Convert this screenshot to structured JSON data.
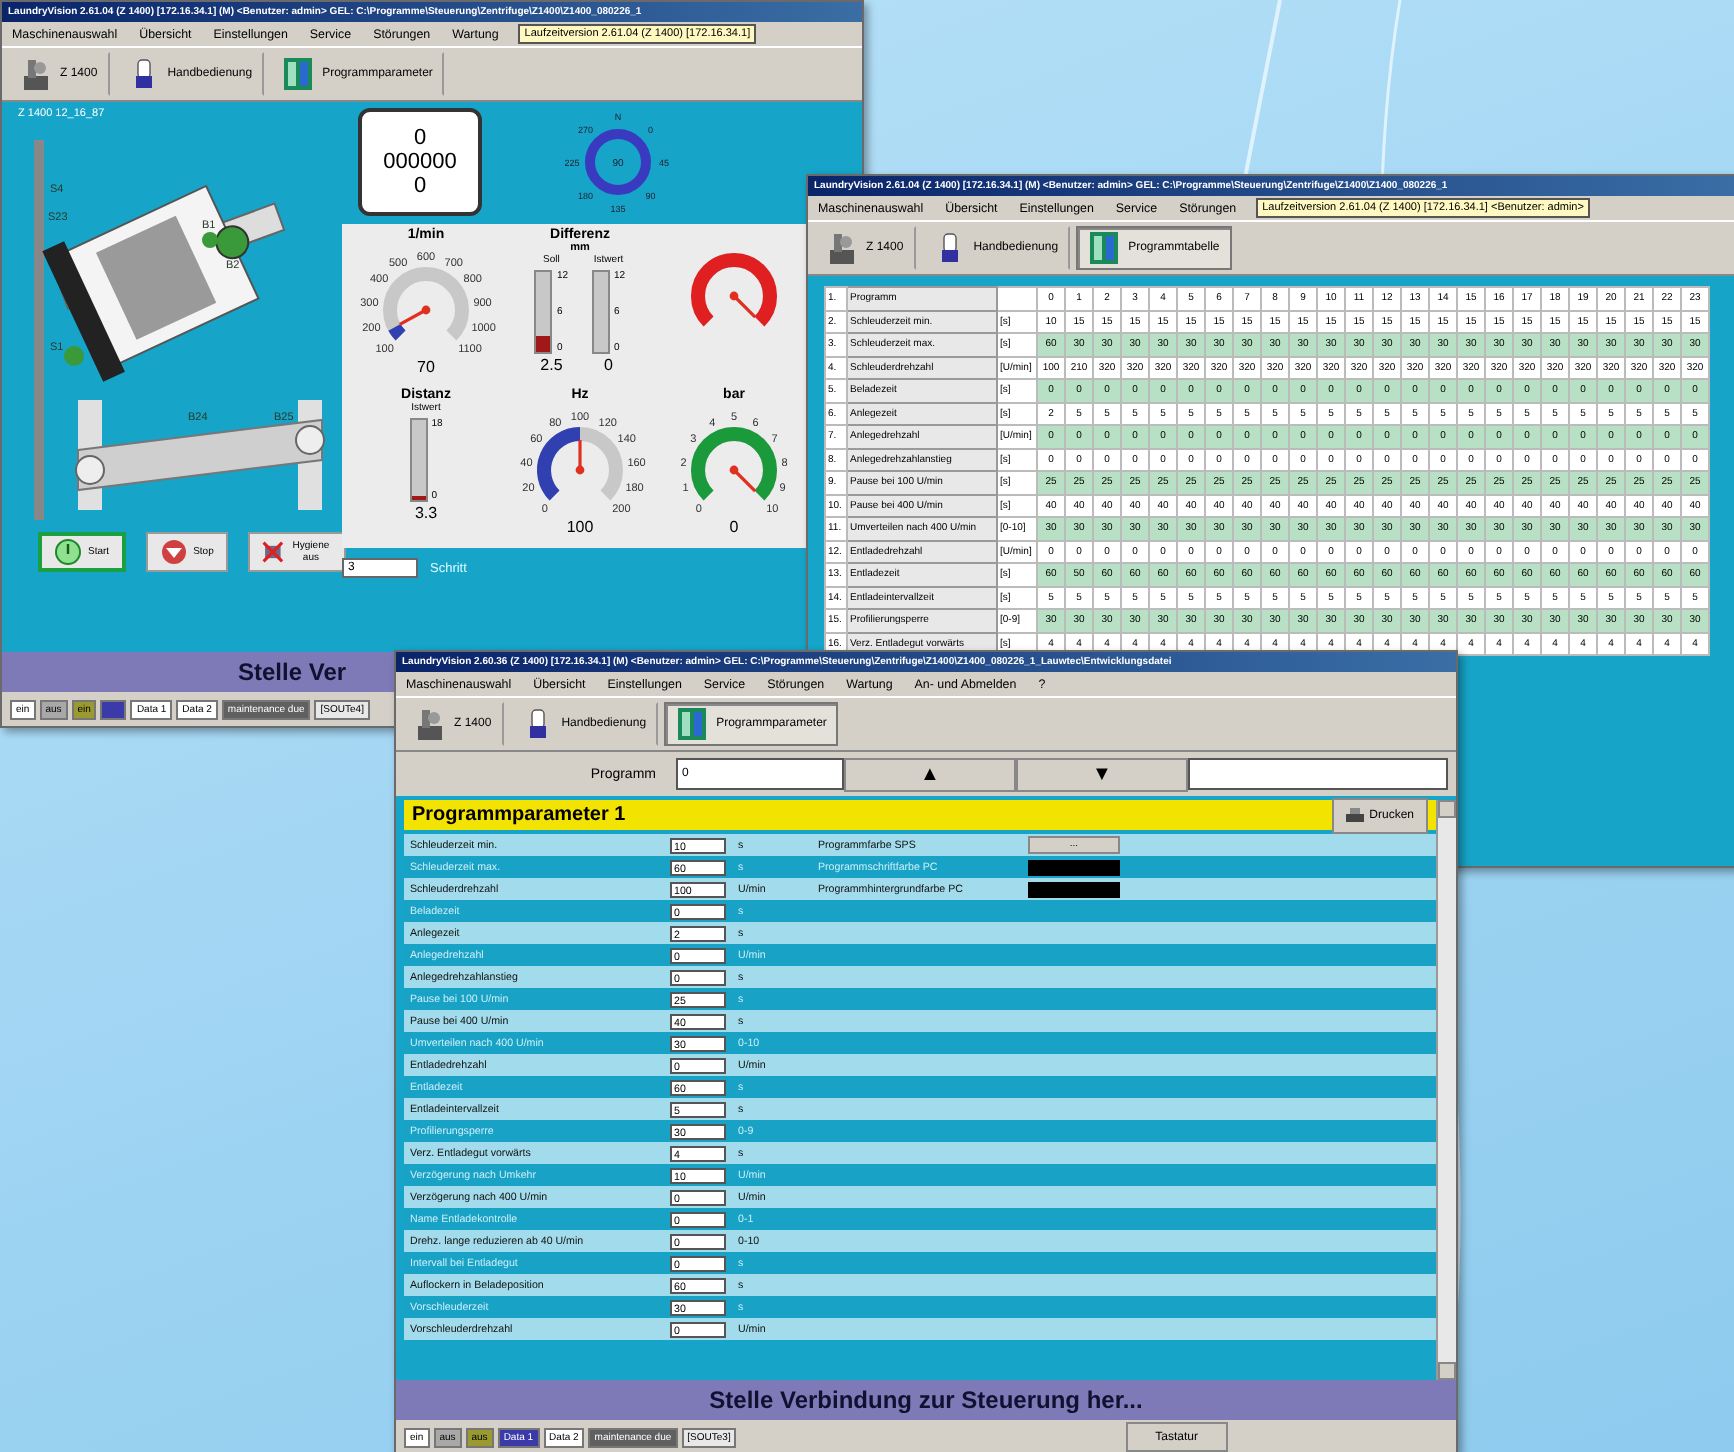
{
  "machine_window": {
    "title": "LaundryVision 2.61.04 (Z 1400) [172.16.34.1] (M) <Benutzer: admin> GEL: C:\\Programme\\Steuerung\\Zentrifuge\\Z1400\\Z1400_080226_1",
    "menu": [
      "Maschinenauswahl",
      "Übersicht",
      "Einstellungen",
      "Service",
      "Störungen",
      "Wartung"
    ],
    "path_box": "Laufzeitversion 2.61.04 (Z 1400) [172.16.34.1]",
    "toolbar": [
      {
        "label": "Z 1400",
        "selected": false
      },
      {
        "label": "Handbedienung",
        "selected": false
      },
      {
        "label": "Programmparameter",
        "selected": false
      }
    ],
    "machine_label": "Z 1400 12_16_87",
    "drawing_labels": [
      "S4",
      "S23",
      "S1",
      "B1",
      "B2",
      "B24",
      "B25"
    ],
    "counter": [
      "0",
      "000000",
      "0"
    ],
    "compass": {
      "center": "90",
      "labels": [
        "N",
        "0",
        "45",
        "90",
        "135",
        "180",
        "225",
        "270"
      ]
    },
    "gauges": [
      {
        "kind": "dial",
        "title": "1/min",
        "ticks": [
          "100",
          "200",
          "300",
          "400",
          "500",
          "600",
          "700",
          "800",
          "900",
          "1000",
          "1100"
        ],
        "reading": "70",
        "level": 0.06,
        "color": "#3040b0"
      },
      {
        "kind": "bars",
        "title": "Differenz",
        "unit": "mm",
        "bars": [
          {
            "label": "Soll",
            "ticks": [
              "12",
              "6",
              "0"
            ],
            "reading": "2.5",
            "level": 0.2
          },
          {
            "label": "Istwert",
            "ticks": [
              "12",
              "6",
              "0"
            ],
            "reading": "0",
            "level": 0
          }
        ]
      },
      {
        "kind": "dial",
        "level": 1,
        "color": "#e02020"
      },
      {
        "kind": "bars",
        "title": "Distanz",
        "bars": [
          {
            "label": "Istwert",
            "ticks": [
              "18",
              "0"
            ],
            "reading": "3.3",
            "level": 0.05
          }
        ]
      },
      {
        "kind": "dial",
        "title": "Hz",
        "ticks": [
          "0",
          "20",
          "40",
          "60",
          "80",
          "100",
          "120",
          "140",
          "160",
          "180",
          "200"
        ],
        "reading": "100",
        "level": 0.5,
        "color": "#3040b0"
      },
      {
        "kind": "dial",
        "title": "bar",
        "ticks": [
          "0",
          "1",
          "2",
          "3",
          "4",
          "5",
          "6",
          "7",
          "8",
          "9",
          "10"
        ],
        "reading": "0",
        "level": 1,
        "color": "#1a9a3a"
      }
    ],
    "step": {
      "value": "3",
      "label": "Schritt"
    },
    "buttons": [
      {
        "kind": "start",
        "label": "Start"
      },
      {
        "kind": "stop",
        "label": "Stop"
      },
      {
        "kind": "hygiene",
        "label": "Hygiene aus"
      }
    ],
    "status_message": "Stelle Ver",
    "status_bar": [
      {
        "kind": "text",
        "text": "ein",
        "color": "#ffffff"
      },
      {
        "kind": "text",
        "text": "aus",
        "color": "#a8a8a8"
      },
      {
        "kind": "text",
        "text": "ein",
        "color": "#9a9a30"
      },
      {
        "kind": "swatch",
        "color": "#3a3aa8"
      },
      {
        "kind": "text",
        "text": "Data 1",
        "color": "#ffffff"
      },
      {
        "kind": "text",
        "text": "Data 2",
        "color": "#ffffff"
      },
      {
        "kind": "text",
        "text": "maintenance due",
        "color": "#606060"
      },
      {
        "kind": "text",
        "text": "[SOUTe4]",
        "color": "#e8e8e8"
      }
    ]
  },
  "table_window": {
    "title": "LaundryVision 2.61.04 (Z 1400) [172.16.34.1] (M) <Benutzer: admin> GEL: C:\\Programme\\Steuerung\\Zentrifuge\\Z1400\\Z1400_080226_1",
    "menu": [
      "Maschinenauswahl",
      "Übersicht",
      "Einstellungen",
      "Service",
      "Störungen"
    ],
    "path_box": "Laufzeitversion 2.61.04 (Z 1400) [172.16.34.1] <Benutzer: admin>",
    "toolbar": [
      {
        "label": "Z 1400",
        "selected": false
      },
      {
        "label": "Handbedienung",
        "selected": false
      },
      {
        "label": "Programmtabelle",
        "selected": true
      }
    ],
    "rows": [
      {
        "number": "1.",
        "name": "Programm",
        "values": [
          "0",
          "1",
          "2",
          "3",
          "4",
          "5",
          "6",
          "7",
          "8",
          "9",
          "10",
          "11",
          "12",
          "13",
          "14",
          "15",
          "16",
          "17",
          "18",
          "19",
          "20",
          "21",
          "22",
          "23"
        ]
      },
      {
        "number": "2.",
        "name": "Schleuderzeit min.",
        "unit": "[s]",
        "values": [
          "10",
          "15",
          "15",
          "15",
          "15",
          "15",
          "15",
          "15",
          "15",
          "15",
          "15",
          "15",
          "15",
          "15",
          "15",
          "15",
          "15",
          "15",
          "15",
          "15",
          "15",
          "15",
          "15",
          "15"
        ]
      },
      {
        "number": "3.",
        "name": "Schleuderzeit max.",
        "unit": "[s]",
        "values": [
          "60",
          "30",
          "30",
          "30",
          "30",
          "30",
          "30",
          "30",
          "30",
          "30",
          "30",
          "30",
          "30",
          "30",
          "30",
          "30",
          "30",
          "30",
          "30",
          "30",
          "30",
          "30",
          "30",
          "30"
        ]
      },
      {
        "number": "4.",
        "name": "Schleuderdrehzahl",
        "unit": "[U/min]",
        "values": [
          "100",
          "210",
          "320",
          "320",
          "320",
          "320",
          "320",
          "320",
          "320",
          "320",
          "320",
          "320",
          "320",
          "320",
          "320",
          "320",
          "320",
          "320",
          "320",
          "320",
          "320",
          "320",
          "320",
          "320"
        ]
      },
      {
        "number": "5.",
        "name": "Beladezeit",
        "unit": "[s]",
        "values": [
          "0",
          "0",
          "0",
          "0",
          "0",
          "0",
          "0",
          "0",
          "0",
          "0",
          "0",
          "0",
          "0",
          "0",
          "0",
          "0",
          "0",
          "0",
          "0",
          "0",
          "0",
          "0",
          "0",
          "0"
        ]
      },
      {
        "number": "6.",
        "name": "Anlegezeit",
        "unit": "[s]",
        "values": [
          "2",
          "5",
          "5",
          "5",
          "5",
          "5",
          "5",
          "5",
          "5",
          "5",
          "5",
          "5",
          "5",
          "5",
          "5",
          "5",
          "5",
          "5",
          "5",
          "5",
          "5",
          "5",
          "5",
          "5"
        ]
      },
      {
        "number": "7.",
        "name": "Anlegedrehzahl",
        "unit": "[U/min]",
        "values": [
          "0",
          "0",
          "0",
          "0",
          "0",
          "0",
          "0",
          "0",
          "0",
          "0",
          "0",
          "0",
          "0",
          "0",
          "0",
          "0",
          "0",
          "0",
          "0",
          "0",
          "0",
          "0",
          "0",
          "0"
        ]
      },
      {
        "number": "8.",
        "name": "Anlegedrehzahlanstieg",
        "unit": "[s]",
        "values": [
          "0",
          "0",
          "0",
          "0",
          "0",
          "0",
          "0",
          "0",
          "0",
          "0",
          "0",
          "0",
          "0",
          "0",
          "0",
          "0",
          "0",
          "0",
          "0",
          "0",
          "0",
          "0",
          "0",
          "0"
        ]
      },
      {
        "number": "9.",
        "name": "Pause bei 100 U/min",
        "unit": "[s]",
        "values": [
          "25",
          "25",
          "25",
          "25",
          "25",
          "25",
          "25",
          "25",
          "25",
          "25",
          "25",
          "25",
          "25",
          "25",
          "25",
          "25",
          "25",
          "25",
          "25",
          "25",
          "25",
          "25",
          "25",
          "25"
        ]
      },
      {
        "number": "10.",
        "name": "Pause bei 400 U/min",
        "unit": "[s]",
        "values": [
          "40",
          "40",
          "40",
          "40",
          "40",
          "40",
          "40",
          "40",
          "40",
          "40",
          "40",
          "40",
          "40",
          "40",
          "40",
          "40",
          "40",
          "40",
          "40",
          "40",
          "40",
          "40",
          "40",
          "40"
        ]
      },
      {
        "number": "11.",
        "name": "Umverteilen nach 400 U/min",
        "unit": "[0-10]",
        "values": [
          "30",
          "30",
          "30",
          "30",
          "30",
          "30",
          "30",
          "30",
          "30",
          "30",
          "30",
          "30",
          "30",
          "30",
          "30",
          "30",
          "30",
          "30",
          "30",
          "30",
          "30",
          "30",
          "30",
          "30"
        ]
      },
      {
        "number": "12.",
        "name": "Entladedrehzahl",
        "unit": "[U/min]",
        "values": [
          "0",
          "0",
          "0",
          "0",
          "0",
          "0",
          "0",
          "0",
          "0",
          "0",
          "0",
          "0",
          "0",
          "0",
          "0",
          "0",
          "0",
          "0",
          "0",
          "0",
          "0",
          "0",
          "0",
          "0"
        ]
      },
      {
        "number": "13.",
        "name": "Entladezeit",
        "unit": "[s]",
        "values": [
          "60",
          "50",
          "60",
          "60",
          "60",
          "60",
          "60",
          "60",
          "60",
          "60",
          "60",
          "60",
          "60",
          "60",
          "60",
          "60",
          "60",
          "60",
          "60",
          "60",
          "60",
          "60",
          "60",
          "60"
        ]
      },
      {
        "number": "14.",
        "name": "Entladeintervallzeit",
        "unit": "[s]",
        "values": [
          "5",
          "5",
          "5",
          "5",
          "5",
          "5",
          "5",
          "5",
          "5",
          "5",
          "5",
          "5",
          "5",
          "5",
          "5",
          "5",
          "5",
          "5",
          "5",
          "5",
          "5",
          "5",
          "5",
          "5"
        ]
      },
      {
        "number": "15.",
        "name": "Profilierungsperre",
        "unit": "[0-9]",
        "values": [
          "30",
          "30",
          "30",
          "30",
          "30",
          "30",
          "30",
          "30",
          "30",
          "30",
          "30",
          "30",
          "30",
          "30",
          "30",
          "30",
          "30",
          "30",
          "30",
          "30",
          "30",
          "30",
          "30",
          "30"
        ]
      },
      {
        "number": "16.",
        "name": "Verz. Entladegut vorwärts",
        "unit": "[s]",
        "values": [
          "4",
          "4",
          "4",
          "4",
          "4",
          "4",
          "4",
          "4",
          "4",
          "4",
          "4",
          "4",
          "4",
          "4",
          "4",
          "4",
          "4",
          "4",
          "4",
          "4",
          "4",
          "4",
          "4",
          "4"
        ]
      }
    ]
  },
  "param_window": {
    "title": "LaundryVision 2.60.36 (Z 1400) [172.16.34.1] (M) <Benutzer: admin> GEL: C:\\Programme\\Steuerung\\Zentrifuge\\Z1400\\Z1400_080226_1_Lauwtec\\Entwicklungsdatei",
    "menu": [
      "Maschinenauswahl",
      "Übersicht",
      "Einstellungen",
      "Service",
      "Störungen",
      "Wartung",
      "An- und Abmelden",
      "?"
    ],
    "toolbar": [
      {
        "label": "Z 1400",
        "selected": false
      },
      {
        "label": "Handbedienung",
        "selected": false
      },
      {
        "label": "Programmparameter",
        "selected": true
      }
    ],
    "program": {
      "label": "Programm",
      "value": "0",
      "up": "▲",
      "down": "▼"
    },
    "header": "Programmparameter 1",
    "print_button": "Drucken",
    "color_settings": [
      {
        "kind": "button",
        "label": "Programmfarbe SPS",
        "text": "..."
      },
      {
        "kind": "swatch",
        "label": "Programmschriftfarbe PC",
        "color": "#000000"
      },
      {
        "kind": "swatch",
        "label": "Programmhintergrundfarbe PC",
        "color": "#000000"
      }
    ],
    "params": [
      {
        "name": "Schleuderzeit min.",
        "value": "10",
        "unit": "s"
      },
      {
        "name": "Schleuderzeit max.",
        "value": "60",
        "unit": "s"
      },
      {
        "name": "Schleuderdrehzahl",
        "value": "100",
        "unit": "U/min"
      },
      {
        "name": "Beladezeit",
        "value": "0",
        "unit": "s"
      },
      {
        "name": "Anlegezeit",
        "value": "2",
        "unit": "s"
      },
      {
        "name": "Anlegedrehzahl",
        "value": "0",
        "unit": "U/min"
      },
      {
        "name": "Anlegedrehzahlanstieg",
        "value": "0",
        "unit": "s"
      },
      {
        "name": "Pause bei 100 U/min",
        "value": "25",
        "unit": "s"
      },
      {
        "name": "Pause bei 400 U/min",
        "value": "40",
        "unit": "s"
      },
      {
        "name": "Umverteilen nach 400 U/min",
        "value": "30",
        "unit": "0-10"
      },
      {
        "name": "Entladedrehzahl",
        "value": "0",
        "unit": "U/min"
      },
      {
        "name": "Entladezeit",
        "value": "60",
        "unit": "s"
      },
      {
        "name": "Entladeintervallzeit",
        "value": "5",
        "unit": "s"
      },
      {
        "name": "Profilierungsperre",
        "value": "30",
        "unit": "0-9"
      },
      {
        "name": "Verz. Entladegut vorwärts",
        "value": "4",
        "unit": "s"
      },
      {
        "name": "Verzögerung nach Umkehr",
        "value": "10",
        "unit": "U/min"
      },
      {
        "name": "Verzögerung nach 400 U/min",
        "value": "0",
        "unit": "U/min"
      },
      {
        "name": "Name Entladekontrolle",
        "value": "0",
        "unit": "0-1"
      },
      {
        "name": "Drehz. lange reduzieren ab 40 U/min",
        "value": "0",
        "unit": "0-10"
      },
      {
        "name": "Intervall bei Entladegut",
        "value": "0",
        "unit": "s"
      },
      {
        "name": "Auflockern in Beladeposition",
        "value": "60",
        "unit": "s"
      },
      {
        "name": "Vorschleuderzeit",
        "value": "30",
        "unit": "s"
      },
      {
        "name": "Vorschleuderdrehzahl",
        "value": "0",
        "unit": "U/min"
      }
    ],
    "status_message": "Stelle Verbindung zur Steuerung her...",
    "status_bar": [
      {
        "kind": "text",
        "text": "ein",
        "color": "#ffffff"
      },
      {
        "kind": "text",
        "text": "aus",
        "color": "#a8a8a8"
      },
      {
        "kind": "text",
        "text": "aus",
        "color": "#9a9a30"
      },
      {
        "kind": "text",
        "text": "Data 1",
        "color": "#3a3aa8"
      },
      {
        "kind": "text",
        "text": "Data 2",
        "color": "#ffffff"
      },
      {
        "kind": "text",
        "text": "maintenance due",
        "color": "#606060"
      },
      {
        "kind": "text",
        "text": "[SOUTe3]",
        "color": "#e8e8e8"
      }
    ],
    "keyboard_button": "Tastatur"
  }
}
